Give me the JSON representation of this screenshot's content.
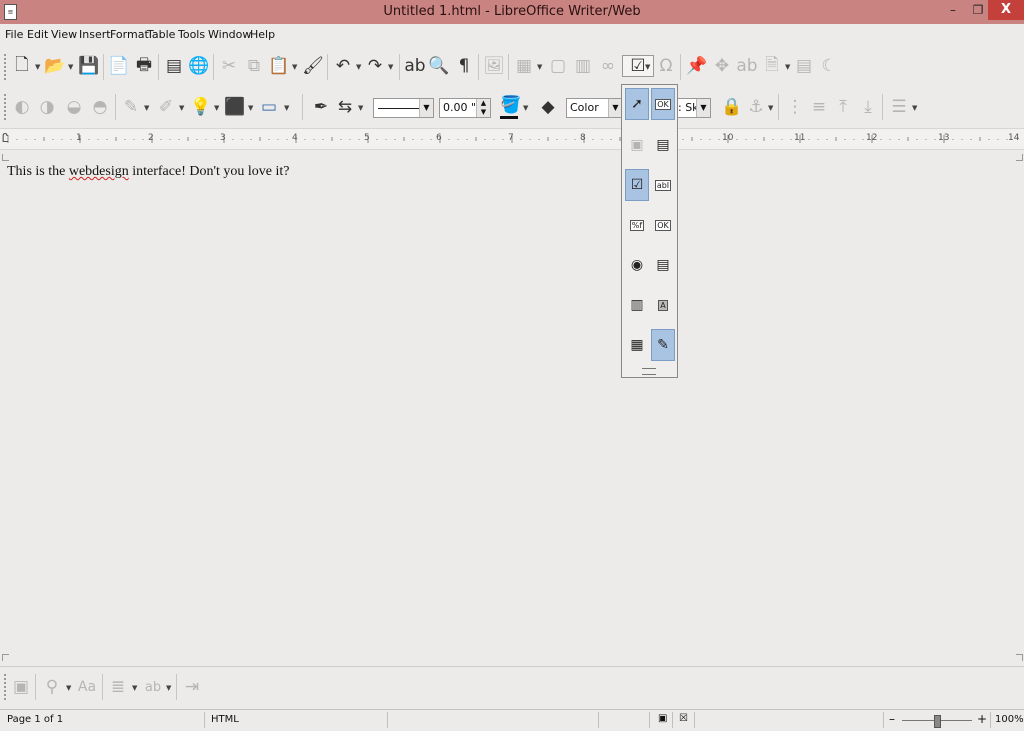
{
  "window": {
    "title": "Untitled 1.html - LibreOffice Writer/Web",
    "min_label": "–",
    "max_label": "❐",
    "close_label": "X"
  },
  "menubar": {
    "items": [
      {
        "label": "File"
      },
      {
        "label": "Edit"
      },
      {
        "label": "View"
      },
      {
        "label": "Insert"
      },
      {
        "label": "Format"
      },
      {
        "label": "Table"
      },
      {
        "label": "Tools"
      },
      {
        "label": "Window"
      },
      {
        "label": "Help"
      }
    ]
  },
  "toolbar2": {
    "line_width_value": "0.00 \"",
    "area_style_value": "Color",
    "area_color_value": ": Sky"
  },
  "ruler": {
    "numbers": [
      "1",
      "2",
      "3",
      "4",
      "5",
      "6",
      "7",
      "8",
      "9",
      "10",
      "11",
      "12",
      "13",
      "14"
    ]
  },
  "document": {
    "text_before": "This is the ",
    "misspelled_word": "webdesign",
    "text_after": " interface! Don't you love it?"
  },
  "form_controls_popup": {
    "items": [
      {
        "name": "select-icon",
        "selected": true
      },
      {
        "name": "push-button-icon",
        "selected": true
      },
      {
        "name": "form-design-icon",
        "disabled": true
      },
      {
        "name": "form-navigator-icon"
      },
      {
        "name": "checkbox-icon",
        "selected": true
      },
      {
        "name": "text-box-icon"
      },
      {
        "name": "formatted-field-icon"
      },
      {
        "name": "push-button-ok-icon"
      },
      {
        "name": "option-button-icon"
      },
      {
        "name": "list-box-icon"
      },
      {
        "name": "combo-box-icon"
      },
      {
        "name": "label-field-icon"
      },
      {
        "name": "control-properties-icon"
      },
      {
        "name": "design-mode-icon",
        "selected": true
      }
    ]
  },
  "statusbar": {
    "page": "Page 1 of 1",
    "mode": "HTML",
    "zoom": "100%",
    "zoom_minus": "–",
    "zoom_plus": "+"
  }
}
